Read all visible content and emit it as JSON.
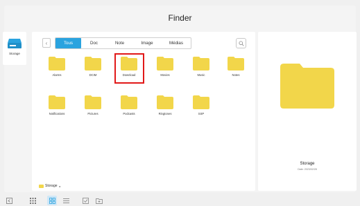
{
  "window": {
    "title": "Finder"
  },
  "sidebar": {
    "items": [
      {
        "label": "Storage",
        "icon": "drive-icon"
      }
    ]
  },
  "toolbar": {
    "back_icon": "chevron-left-icon",
    "tabs": [
      {
        "label": "Tous",
        "active": true
      },
      {
        "label": "Doc",
        "active": false
      },
      {
        "label": "Note",
        "active": false
      },
      {
        "label": "Image",
        "active": false
      },
      {
        "label": "Médias",
        "active": false
      }
    ],
    "search_icon": "search-icon",
    "accent_color": "#2aa3df"
  },
  "folders": [
    {
      "name": "Alarms"
    },
    {
      "name": "DCIM"
    },
    {
      "name": "Download",
      "selected": true
    },
    {
      "name": "Movies"
    },
    {
      "name": "Music"
    },
    {
      "name": "Notes"
    },
    {
      "name": "Notifications"
    },
    {
      "name": "Pictures"
    },
    {
      "name": "Podcasts"
    },
    {
      "name": "Ringtones"
    },
    {
      "name": "SSP"
    }
  ],
  "folder_color": "#f2d64a",
  "selection_color": "#e11818",
  "pathbar": {
    "location": "Storage",
    "arrow": "▸"
  },
  "preview": {
    "name": "Storage",
    "subtitle": "Date: 2023/02/28"
  },
  "bottom_bar": {
    "buttons": [
      {
        "icon": "back-square-icon",
        "active": false
      },
      {
        "icon": "grid-small-icon",
        "active": false
      },
      {
        "icon": "grid-large-icon",
        "active": true
      },
      {
        "icon": "list-view-icon",
        "active": false
      },
      {
        "icon": "checkbox-select-icon",
        "active": false
      },
      {
        "icon": "new-folder-icon",
        "active": false
      }
    ]
  }
}
